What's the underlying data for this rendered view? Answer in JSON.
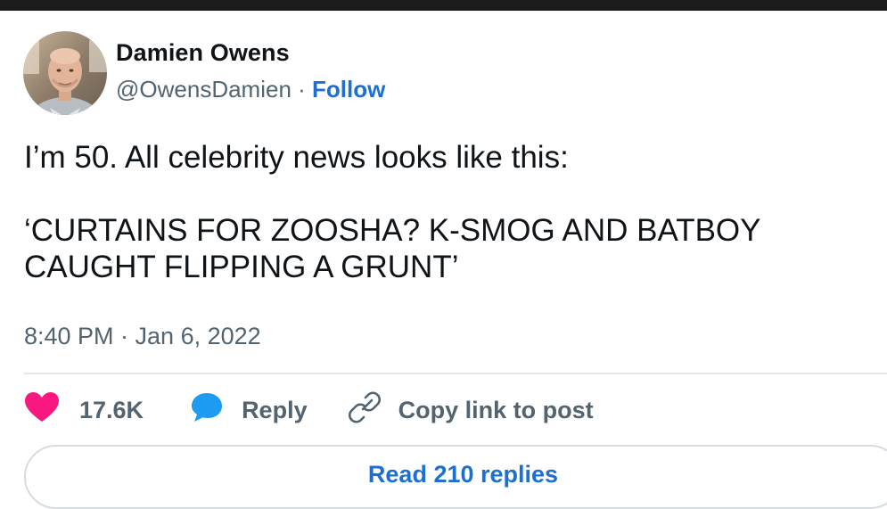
{
  "tweet": {
    "author_name": "Damien Owens",
    "handle": "@OwensDamien",
    "separator": " · ",
    "follow_label": "Follow",
    "text_line1": "I’m 50. All celebrity news looks like this:",
    "text_quote": "‘CURTAINS FOR ZOOSHA? K-SMOG AND BATBOY CAUGHT FLIPPING A GRUNT’",
    "timestamp": "8:40 PM · Jan 6, 2022"
  },
  "actions": {
    "like_count": "17.6K",
    "reply_label": "Reply",
    "copy_label": "Copy link to post",
    "read_replies_label": "Read 210 replies"
  },
  "icons": {
    "like": "heart-icon",
    "reply": "speech-bubble-icon",
    "copy": "link-icon"
  },
  "colors": {
    "accent": "#1d6fd1",
    "like": "#f91880",
    "reply": "#1d9bf0",
    "text": "#0f1419",
    "muted": "#536471"
  }
}
